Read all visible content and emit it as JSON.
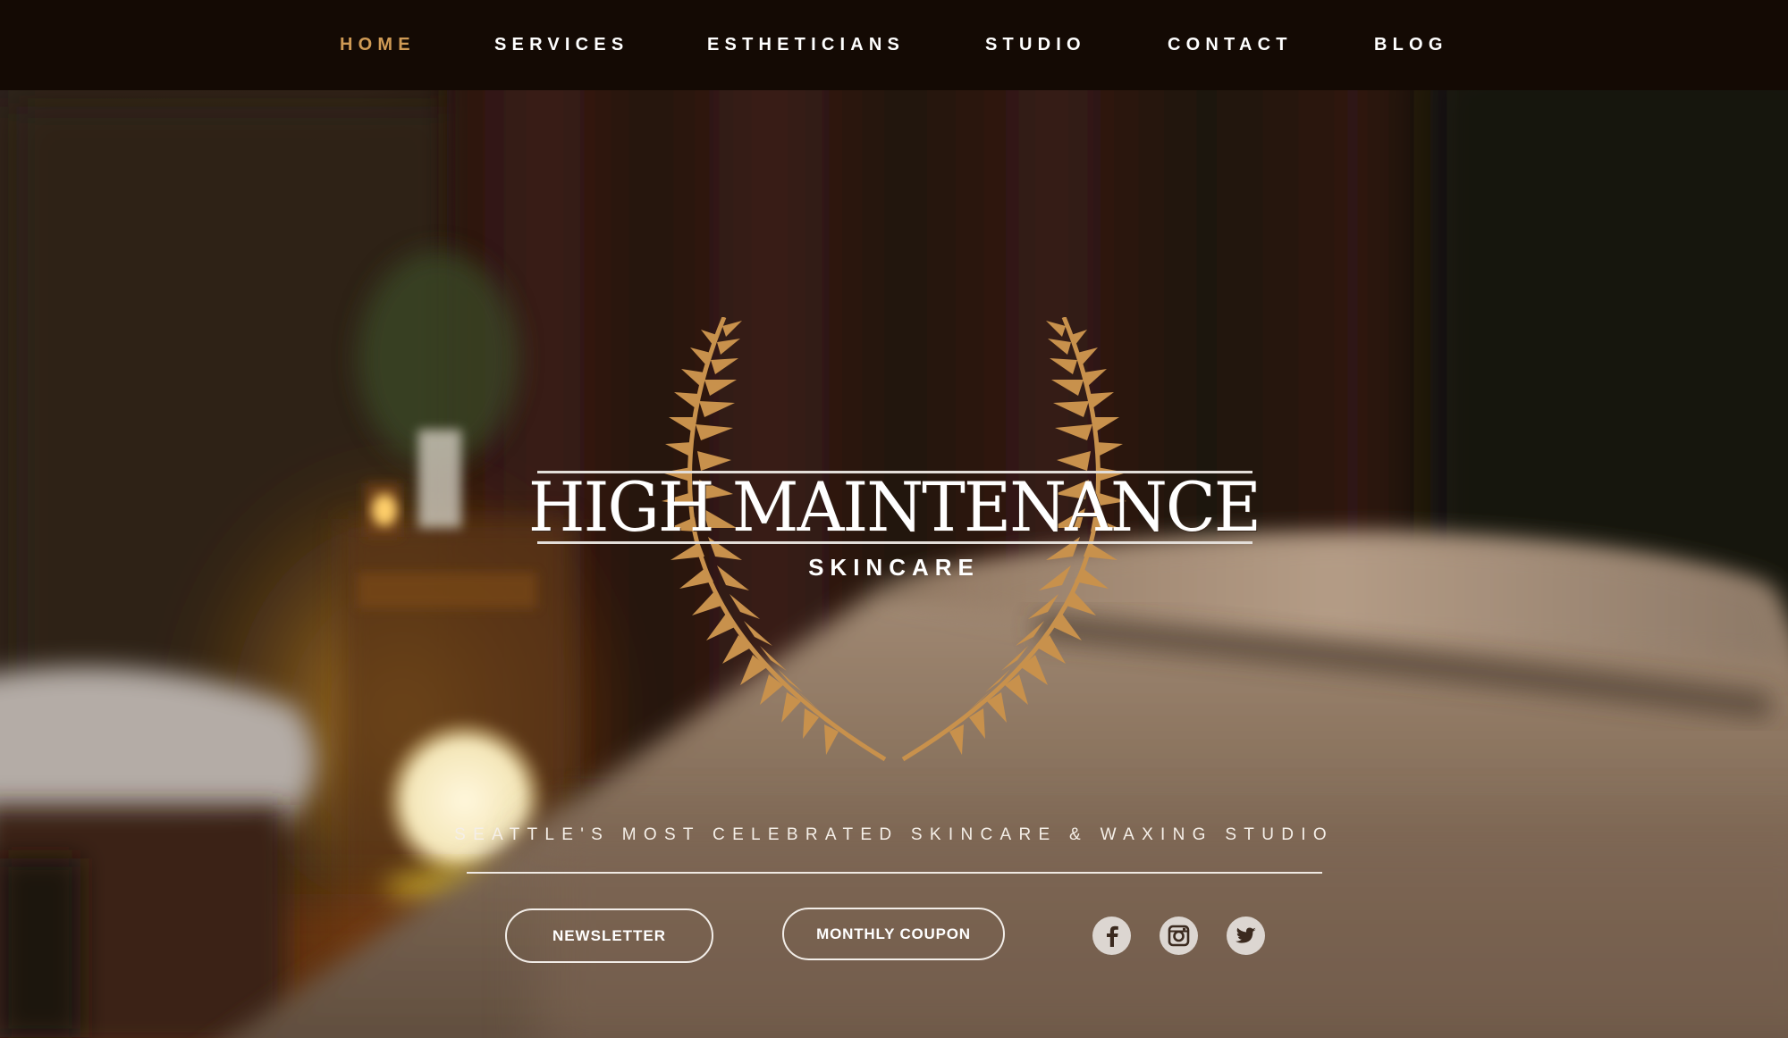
{
  "nav": {
    "items": [
      {
        "label": "HOME",
        "active": true
      },
      {
        "label": "SERVICES",
        "active": false
      },
      {
        "label": "ESTHETICIANS",
        "active": false
      },
      {
        "label": "STUDIO",
        "active": false
      },
      {
        "label": "CONTACT",
        "active": false
      },
      {
        "label": "BLOG",
        "active": false
      }
    ],
    "active_color": "#cf9a55",
    "text_color": "#ffffff",
    "background": "#140a04"
  },
  "logo": {
    "title": "HIGH MAINTENANCE",
    "subtitle": "SKINCARE",
    "emblem_icon": "fern-laurel-wreath-icon",
    "emblem_color": "#c8914c"
  },
  "hero": {
    "tagline": "SEATTLE'S MOST CELEBRATED SKINCARE & WAXING STUDIO"
  },
  "buttons": {
    "newsletter_label": "NEWSLETTER",
    "coupon_label": "MONTHLY COUPON"
  },
  "social": [
    {
      "icon": "facebook-icon"
    },
    {
      "icon": "instagram-icon"
    },
    {
      "icon": "twitter-icon"
    }
  ]
}
